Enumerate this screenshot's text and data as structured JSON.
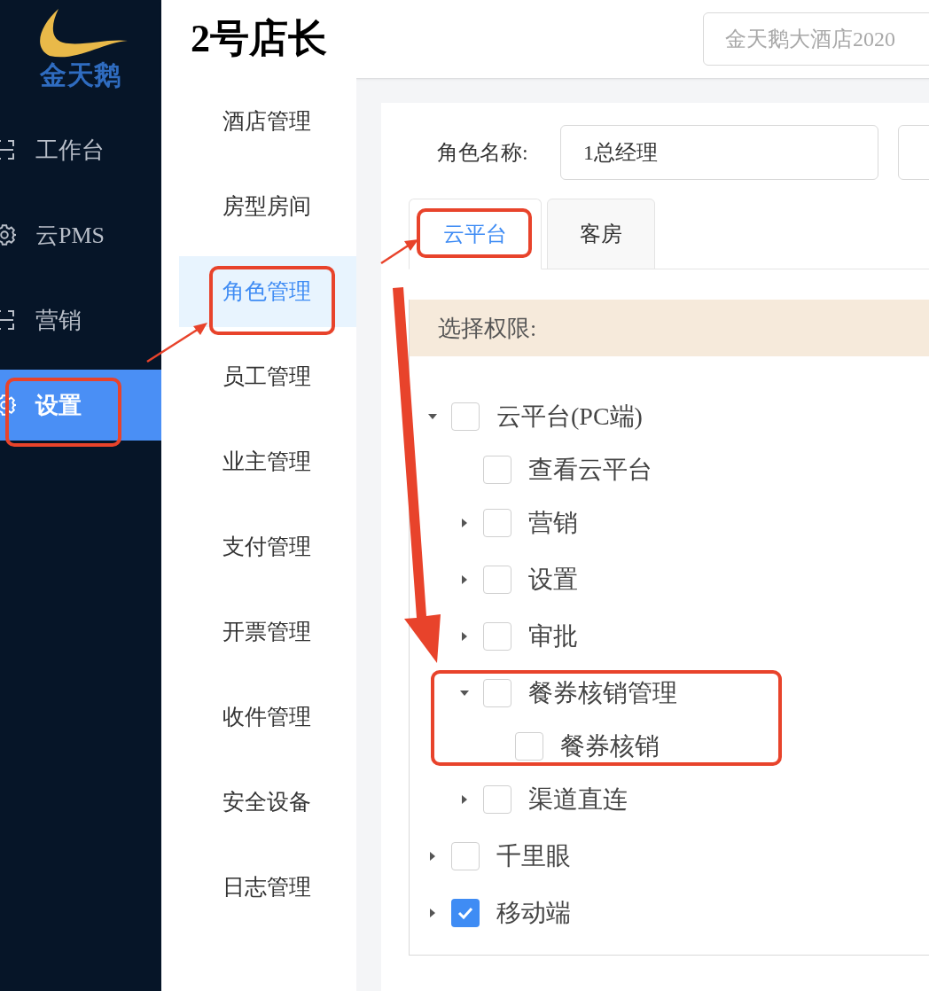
{
  "sidebar": {
    "logo_text": "金天鹅",
    "items": [
      {
        "label": "工作台",
        "kind": "frame",
        "selected": false
      },
      {
        "label": "云PMS",
        "kind": "gear",
        "selected": false
      },
      {
        "label": "营销",
        "kind": "frame",
        "selected": false
      },
      {
        "label": "设置",
        "kind": "gear",
        "selected": true
      }
    ]
  },
  "header": {
    "title": "2号店长",
    "hotel_field": {
      "value": "金天鹅大酒店2020"
    }
  },
  "subnav": {
    "items": [
      {
        "label": "酒店管理",
        "selected": false
      },
      {
        "label": "房型房间",
        "selected": false
      },
      {
        "label": "角色管理",
        "selected": true
      },
      {
        "label": "员工管理",
        "selected": false
      },
      {
        "label": "业主管理",
        "selected": false
      },
      {
        "label": "支付管理",
        "selected": false
      },
      {
        "label": "开票管理",
        "selected": false
      },
      {
        "label": "收件管理",
        "selected": false
      },
      {
        "label": "安全设备",
        "selected": false
      },
      {
        "label": "日志管理",
        "selected": false
      }
    ]
  },
  "form": {
    "role_name_label": "角色名称:",
    "role_name_value": "1总经理"
  },
  "tabs": [
    {
      "label": "云平台",
      "selected": true
    },
    {
      "label": "客房",
      "selected": false
    }
  ],
  "permissions": {
    "title": "选择权限:",
    "tree": [
      {
        "label": "云平台(PC端)",
        "checked": false,
        "expanded": true,
        "children": [
          {
            "label": "查看云平台",
            "checked": false
          },
          {
            "label": "营销",
            "checked": false,
            "expanded": false
          },
          {
            "label": "设置",
            "checked": false,
            "expanded": false
          },
          {
            "label": "审批",
            "checked": false,
            "expanded": false
          },
          {
            "label": "餐券核销管理",
            "checked": false,
            "expanded": true,
            "children": [
              {
                "label": "餐券核销",
                "checked": false
              }
            ]
          },
          {
            "label": "渠道直连",
            "checked": false,
            "expanded": false
          }
        ]
      },
      {
        "label": "千里眼",
        "checked": false,
        "expanded": false
      },
      {
        "label": "移动端",
        "checked": true,
        "expanded": false
      }
    ]
  }
}
